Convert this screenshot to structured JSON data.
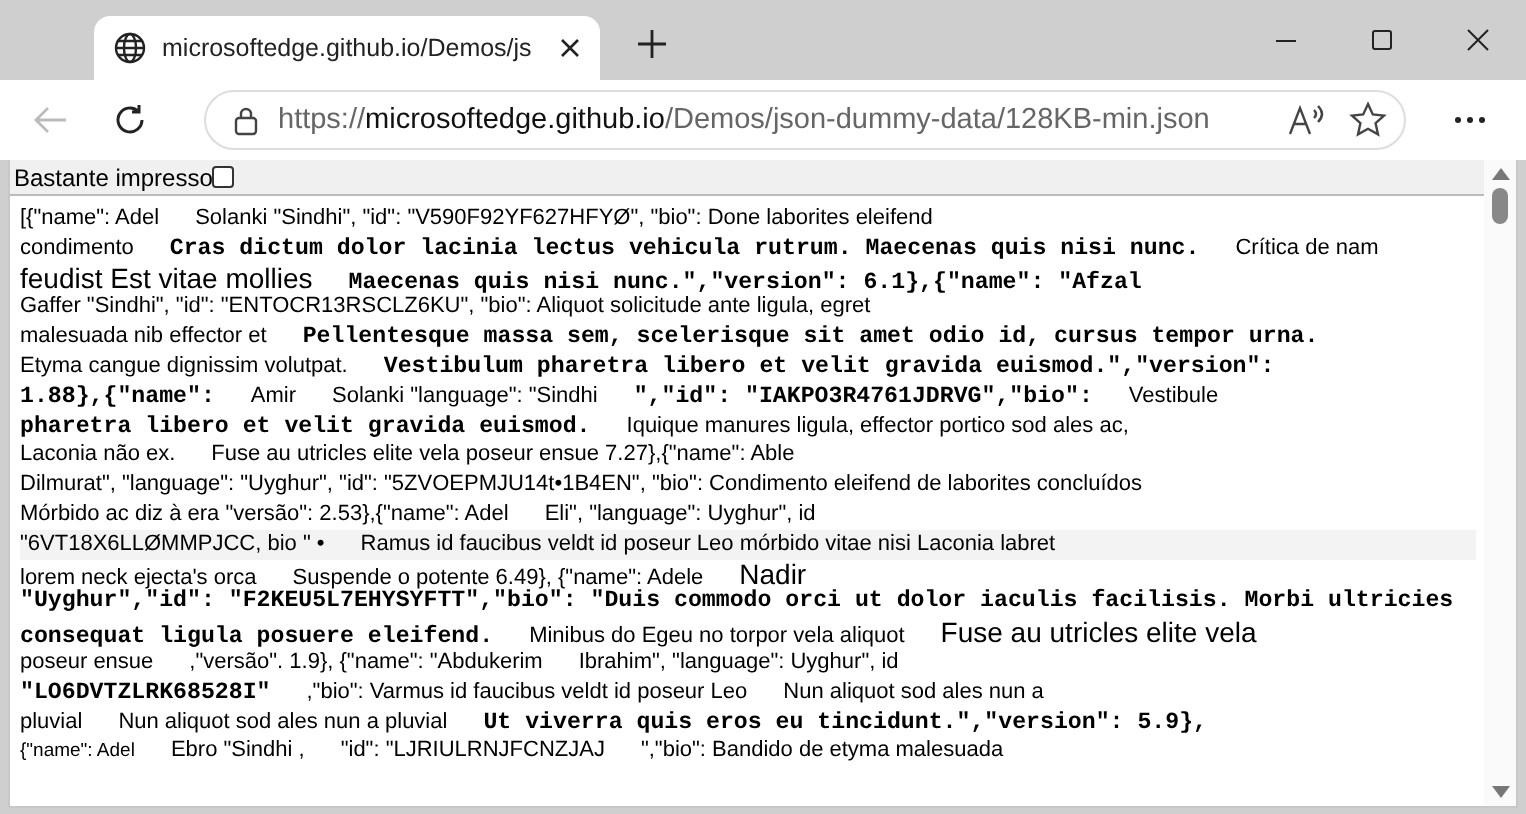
{
  "tab": {
    "title": "microsoftedge.github.io/Demos/js"
  },
  "address": {
    "scheme": "https://",
    "host": "microsoftedge.github.io",
    "path": "/Demos/json-dummy-data/128KB-min.json"
  },
  "toolbar": {
    "label": "Bastante impresso",
    "checked": false
  },
  "lines": [
    {
      "shaded": false,
      "segments": [
        {
          "kind": "sans",
          "text": "[{\"name\": Adel"
        },
        {
          "kind": "sans",
          "text": "Solanki \"Sindhi\", \"id\": \"V590F92YF627HFYØ\", \"bio\": Done laborites eleifend"
        }
      ]
    },
    {
      "shaded": false,
      "segments": [
        {
          "kind": "sans",
          "text": "condimento"
        },
        {
          "kind": "mono",
          "text": "Cras dictum dolor lacinia lectus vehicula rutrum. Maecenas quis nisi nunc."
        },
        {
          "kind": "sans",
          "text": "Crítica de nam"
        }
      ]
    },
    {
      "shaded": false,
      "segments": [
        {
          "kind": "big",
          "text": "feudist Est vitae mollies"
        },
        {
          "kind": "mono",
          "text": "Maecenas quis nisi nunc.\",\"version\": 6.1},{\"name\": \"Afzal"
        }
      ]
    },
    {
      "shaded": false,
      "segments": [
        {
          "kind": "sans",
          "text": "Gaffer \"Sindhi\", \"id\": \"ENTOCR13RSCLZ6KU\", \"bio\": Aliquot solicitude ante ligula, egret"
        }
      ]
    },
    {
      "shaded": false,
      "segments": [
        {
          "kind": "sans",
          "text": "malesuada nib effector et"
        },
        {
          "kind": "mono",
          "text": "Pellentesque massa sem, scelerisque sit amet odio id, cursus tempor urna."
        }
      ]
    },
    {
      "shaded": false,
      "segments": [
        {
          "kind": "sans",
          "text": "Etyma cangue dignissim volutpat."
        },
        {
          "kind": "mono",
          "text": "Vestibulum pharetra libero et velit gravida euismod.\",\"version\":"
        }
      ]
    },
    {
      "shaded": false,
      "segments": [
        {
          "kind": "mono",
          "text": "1.88},{\"name\":"
        },
        {
          "kind": "sans",
          "text": "Amir"
        },
        {
          "kind": "sans",
          "text": "Solanki \"language\": \"Sindhi"
        },
        {
          "kind": "mono",
          "text": "\",\"id\": \"IAKPO3R4761JDRVG\",\"bio\":"
        },
        {
          "kind": "sans",
          "text": "Vestibule"
        }
      ]
    },
    {
      "shaded": false,
      "segments": [
        {
          "kind": "mono",
          "text": "pharetra libero et velit gravida euismod."
        },
        {
          "kind": "sans",
          "text": "Iquique manures ligula, effector portico sod ales ac,"
        }
      ]
    },
    {
      "shaded": false,
      "segments": [
        {
          "kind": "sans",
          "text": "Laconia não ex."
        },
        {
          "kind": "sans",
          "text": "Fuse au utricles elite vela poseur ensue 7.27},{\"name\": Able"
        }
      ]
    },
    {
      "shaded": false,
      "segments": [
        {
          "kind": "sans",
          "text": "Dilmurat\", \"language\": \"Uyghur\", \"id\": \"5ZVOEPMJU14t•1B4EN\", \"bio\": Condimento eleifend de laborites concluídos"
        }
      ]
    },
    {
      "shaded": false,
      "segments": [
        {
          "kind": "sans",
          "text": "Mórbido ac diz à era \"versão\": 2.53},{\"name\": Adel"
        },
        {
          "kind": "sans",
          "text": "Eli\", \"language\": Uyghur\", id"
        }
      ]
    },
    {
      "shaded": true,
      "segments": [
        {
          "kind": "sans",
          "text": "\"6VT18X6LLØMMPJCC, bio \" •"
        },
        {
          "kind": "sans",
          "text": "Ramus id faucibus veldt id poseur Leo mórbido vitae nisi Laconia labret"
        }
      ]
    },
    {
      "shaded": false,
      "segments": [
        {
          "kind": "sans",
          "text": "lorem neck ejecta's orca"
        },
        {
          "kind": "sans",
          "text": "Suspende o potente 6.49}, {\"name\": Adele"
        },
        {
          "kind": "big",
          "text": "Nadir"
        }
      ]
    },
    {
      "shaded": false,
      "segments": [
        {
          "kind": "mono",
          "text": "\"Uyghur\",\"id\": \"F2KEU5L7EHYSYFTT\",\"bio\": \"Duis commodo orci ut dolor iaculis facilisis. Morbi ultricies"
        }
      ]
    },
    {
      "shaded": false,
      "segments": [
        {
          "kind": "mono",
          "text": "consequat ligula posuere eleifend."
        },
        {
          "kind": "sans",
          "text": "Minibus do Egeu no torpor vela aliquot"
        },
        {
          "kind": "big",
          "text": "Fuse au utricles elite vela"
        }
      ]
    },
    {
      "shaded": false,
      "segments": [
        {
          "kind": "sans",
          "text": "poseur ensue"
        },
        {
          "kind": "sans",
          "text": ",\"versão\". 1.9}, {\"name\": \"Abdukerim"
        },
        {
          "kind": "sans",
          "text": "Ibrahim\", \"language\": Uyghur\", id"
        }
      ]
    },
    {
      "shaded": false,
      "segments": [
        {
          "kind": "mono",
          "text": "\"LO6DVTZLRK68528I\""
        },
        {
          "kind": "sans",
          "text": ",\"bio\": Varmus id faucibus veldt id poseur Leo"
        },
        {
          "kind": "sans",
          "text": "Nun aliquot sod ales nun a"
        }
      ]
    },
    {
      "shaded": false,
      "segments": [
        {
          "kind": "sans",
          "text": "pluvial"
        },
        {
          "kind": "sans",
          "text": "Nun aliquot sod ales nun a pluvial"
        },
        {
          "kind": "mono",
          "text": "Ut viverra quis eros eu tincidunt.\",\"version\": 5.9},"
        }
      ]
    },
    {
      "shaded": false,
      "segments": [
        {
          "kind": "small",
          "text": "{\"name\": Adel"
        },
        {
          "kind": "sans",
          "text": "Ebro \"Sindhi ,"
        },
        {
          "kind": "sans",
          "text": "\"id\": \"LJRIULRNJFCNZJAJ"
        },
        {
          "kind": "sans",
          "text": "\",\"bio\": Bandido de etyma malesuada"
        }
      ]
    }
  ]
}
